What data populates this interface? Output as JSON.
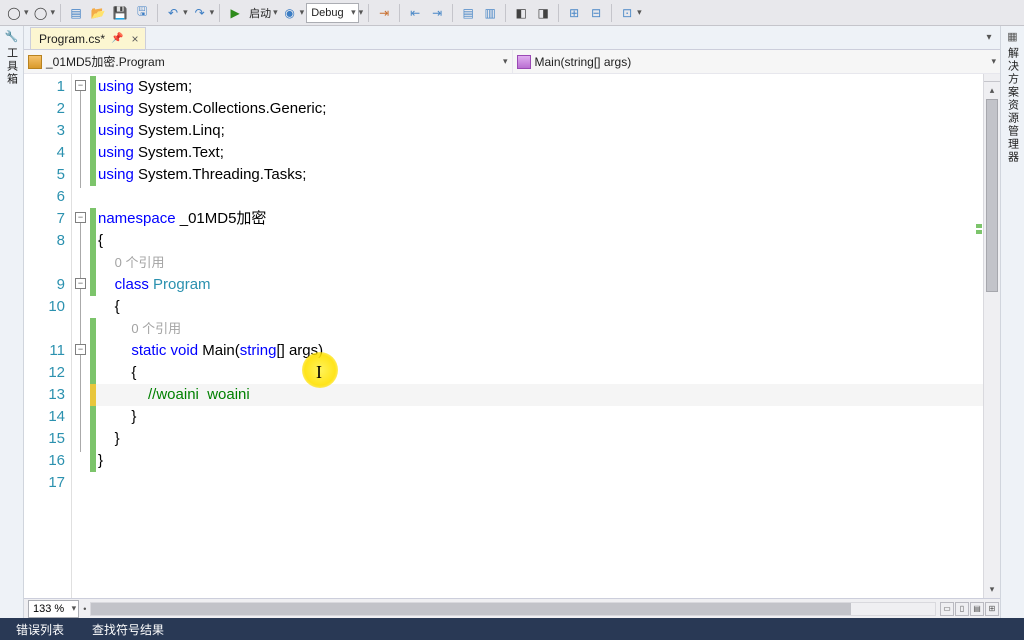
{
  "toolbar": {
    "start_label": "启动",
    "config": "Debug"
  },
  "left_panel_label": "工具箱",
  "right_panel_label": "解决方案资源管理器",
  "tab": {
    "title": "Program.cs*",
    "pin": "📌",
    "close": "×"
  },
  "nav": {
    "class": "_01MD5加密.Program",
    "member": "Main(string[] args)"
  },
  "lines": [
    "1",
    "2",
    "3",
    "4",
    "5",
    "6",
    "7",
    "8",
    "",
    "9",
    "10",
    "",
    "11",
    "12",
    "13",
    "14",
    "15",
    "16",
    "17"
  ],
  "code": {
    "t_using": "using",
    "t_namespace": "namespace",
    "t_class": "class",
    "t_static": "static",
    "t_void": "void",
    "t_string": "string",
    "ns1": " System;",
    "ns2": " System.Collections.Generic;",
    "ns3": " System.Linq;",
    "ns4": " System.Text;",
    "ns5": " System.Threading.Tasks;",
    "ns_decl": " _01MD5加密",
    "ref_txt": "0 个引用",
    "cls_name": "Program",
    "main_sig_a": " Main(",
    "main_sig_b": "[] args)",
    "comment": "//woaini  woaini",
    "ob": "{",
    "cb": "}"
  },
  "zoom": "133 %",
  "status": {
    "errors": "错误列表",
    "find": "查找符号结果"
  }
}
